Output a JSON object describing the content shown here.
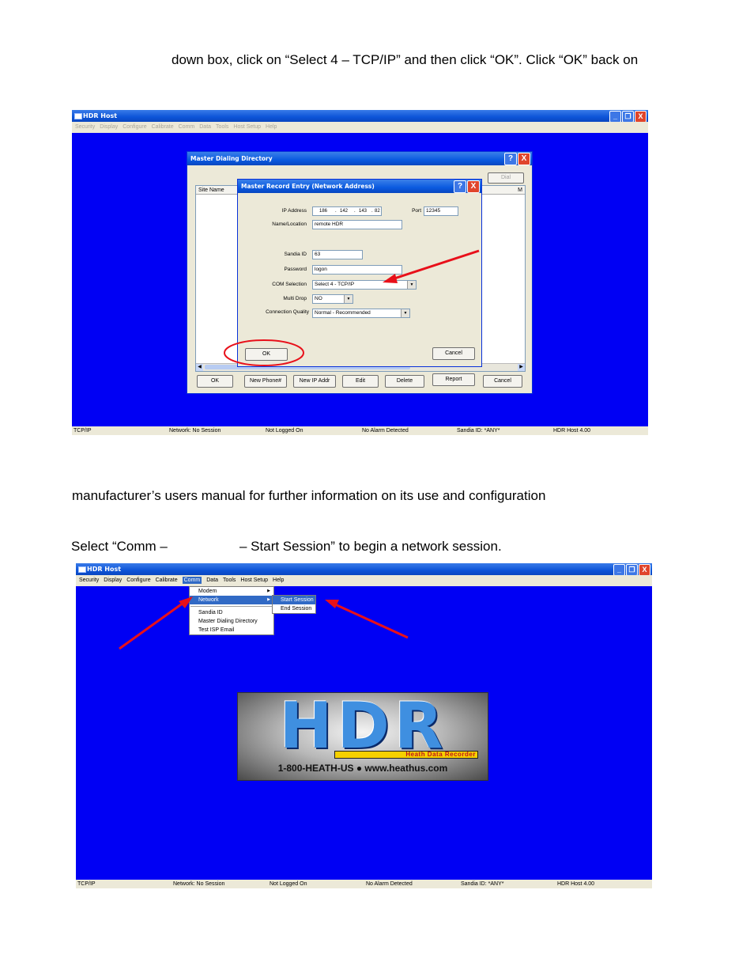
{
  "doc": {
    "line1": "down box, click on “Select 4 – TCP/IP” and then click “OK”. Click “OK” back on",
    "line2": "manufacturer’s users manual for further information on its use and configuration",
    "line3_a": "Select “Comm –",
    "line3_b": "– Start Session” to begin a network session."
  },
  "app": {
    "title": "HDR Host",
    "menu": [
      "Security",
      "Display",
      "Configure",
      "Calibrate",
      "Comm",
      "Data",
      "Tools",
      "Host Setup",
      "Help"
    ],
    "status": [
      "TCP/IP",
      "Network: No Session",
      "Not Logged On",
      "No Alarm Detected",
      "Sandia ID: *ANY*",
      "HDR Host 4.00"
    ],
    "window_buttons": {
      "minimize": "_",
      "restore": "❐",
      "close": "X"
    }
  },
  "dialing": {
    "title": "Master Dialing Directory",
    "col_site": "Site Name",
    "col_m": "M",
    "dial": "Dial",
    "buttons": [
      "OK",
      "New Phone#",
      "New IP Addr",
      "Edit",
      "Delete",
      "Report",
      "Cancel"
    ]
  },
  "record": {
    "title": "Master Record Entry (Network Address)",
    "ip_label": "IP Address",
    "ip": [
      "186",
      "142",
      "143",
      "82"
    ],
    "port_label": "Port",
    "port": "12345",
    "name_label": "Name/Location",
    "name": "remote HDR",
    "sandia_label": "Sandia ID",
    "sandia": "63",
    "password_label": "Password",
    "password": "logon",
    "com_label": "COM Selection",
    "com": "Select 4 - TCP/IP",
    "multi_label": "Multi Drop",
    "multi": "NO",
    "quality_label": "Connection Quality",
    "quality": "Normal - Recommended",
    "ok": "OK",
    "cancel": "Cancel",
    "help": "?",
    "close": "X"
  },
  "comm_menu": {
    "items": [
      "Modem",
      "Network",
      "Sandia ID",
      "Master Dialing Directory",
      "Test ISP Email"
    ],
    "sub": [
      "Start Session",
      "End Session"
    ]
  },
  "logo": {
    "big": "HDR",
    "tagline": "Heath Data Recorder",
    "contact": "1-800-HEATH-US ● www.heathus.com"
  },
  "colors": {
    "desktop": "#0000f4",
    "annotation": "#e8101a",
    "title": "#0a54d8"
  }
}
